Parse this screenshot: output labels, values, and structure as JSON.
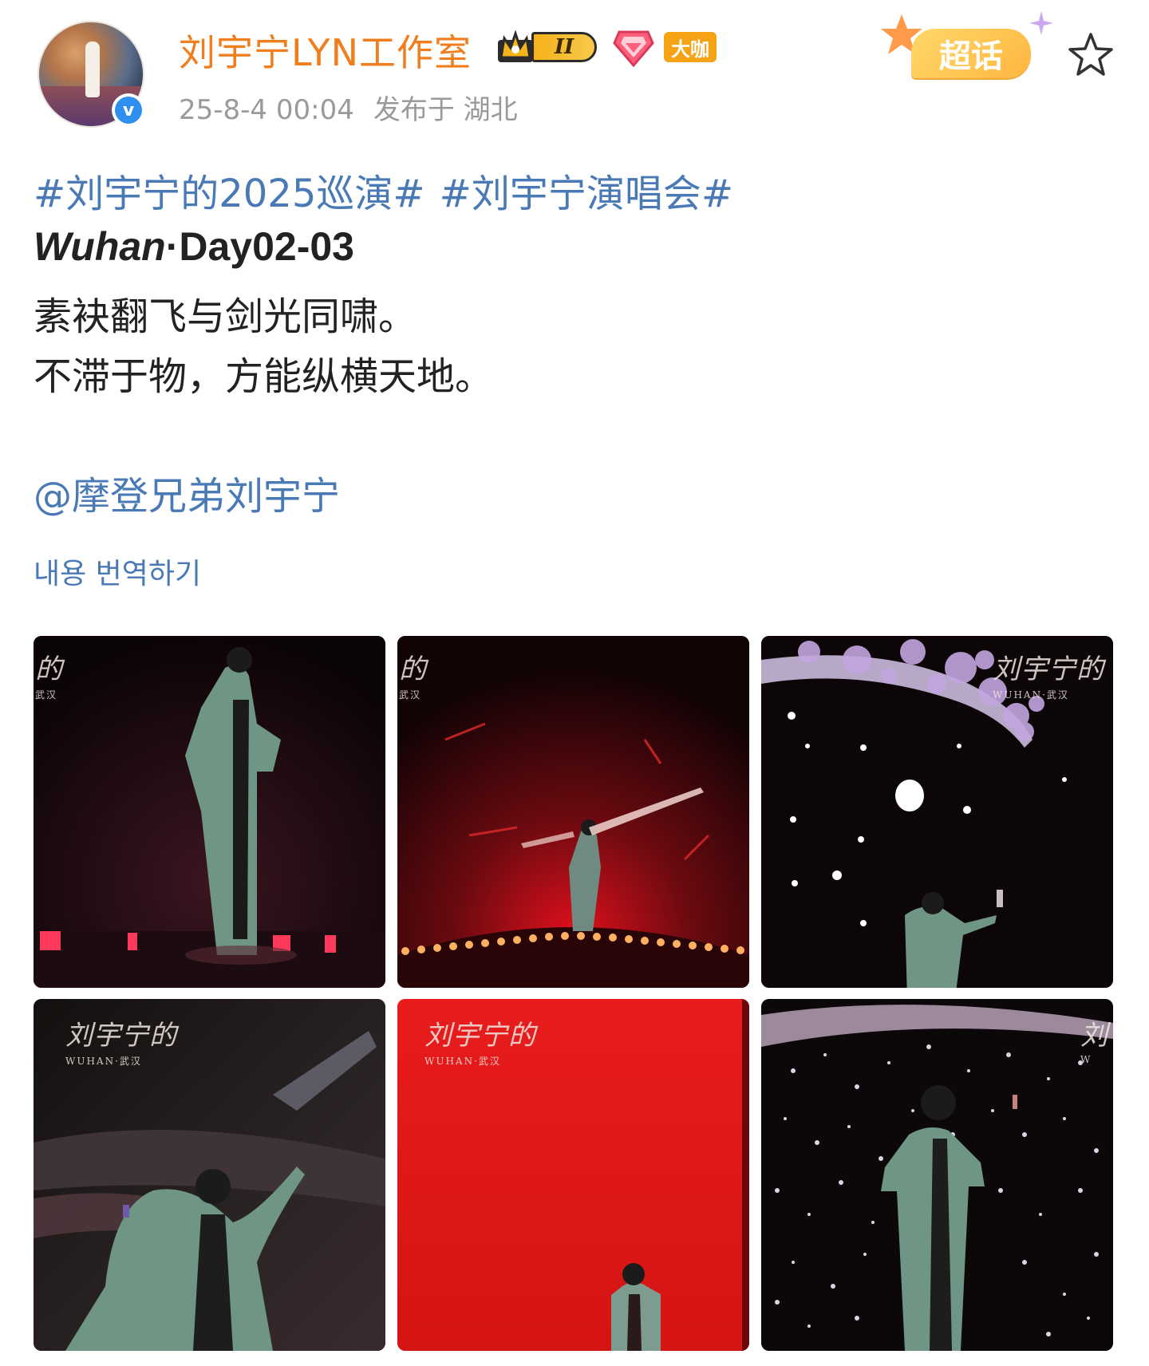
{
  "author": {
    "name": "刘宇宁LYN工作室",
    "level": "II",
    "badge_daka": "大咖",
    "verified_mark": "v",
    "time": "25-8-4 00:04",
    "location": "发布于 湖北"
  },
  "chaohua_label": "超话",
  "post": {
    "topics": [
      "#刘宇宁的2025巡演#",
      "#刘宇宁演唱会#"
    ],
    "day_italic": "Wuhan",
    "day_rest": "·Day02-03",
    "line1": "素袂翻飞与剑光同啸。",
    "line2": "不滞于物，方能纵横天地。",
    "mention": "@摩登兄弟刘宇宁",
    "translate": "내용 번역하기"
  },
  "photos": {
    "wm_partial": "的",
    "wm_partial_sub": "武汉",
    "wm_title": "刘宇宁的",
    "wm_sub": "WUHAN·武汉",
    "wm_edge": "刘",
    "wm_edge_sub": "W"
  },
  "colors": {
    "username": "#f07d1e",
    "link": "#4a7ab6",
    "meta": "#9a9a9a",
    "stage_red": "#e01818"
  },
  "icons": [
    "verified-icon",
    "crown-badge-icon",
    "gem-badge-icon",
    "chaohua-icon",
    "favorite-star-icon"
  ]
}
